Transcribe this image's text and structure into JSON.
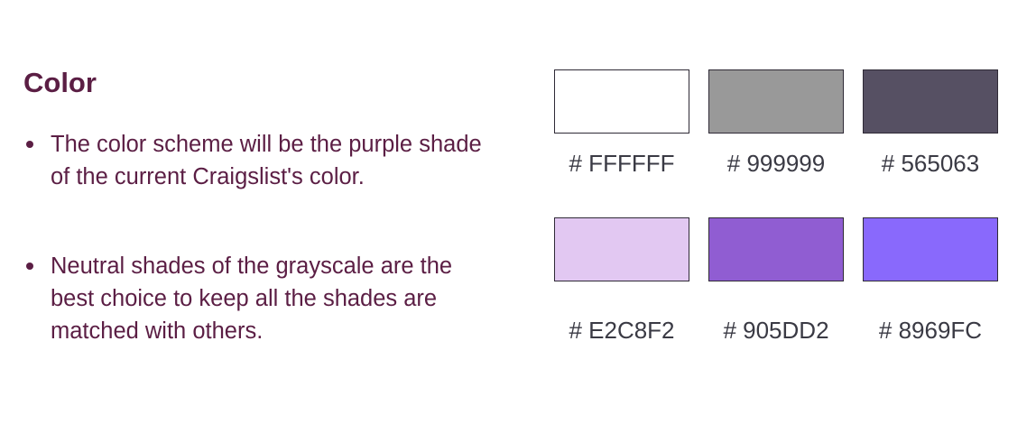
{
  "title": "Color",
  "bullets": [
    {
      "text": "The color scheme will be the purple shade of the current Craigslist's color."
    },
    {
      "text": "Neutral shades of the grayscale are the best choice to keep all the shades are matched with others."
    }
  ],
  "swatches": [
    {
      "label": "# FFFFFF",
      "color": "#FFFFFF"
    },
    {
      "label": "# 999999",
      "color": "#999999"
    },
    {
      "label": "# 565063",
      "color": "#565063"
    },
    {
      "label": "# E2C8F2",
      "color": "#E2C8F2"
    },
    {
      "label": "# 905DD2",
      "color": "#905DD2"
    },
    {
      "label": "# 8969FC",
      "color": "#8969FC"
    }
  ]
}
